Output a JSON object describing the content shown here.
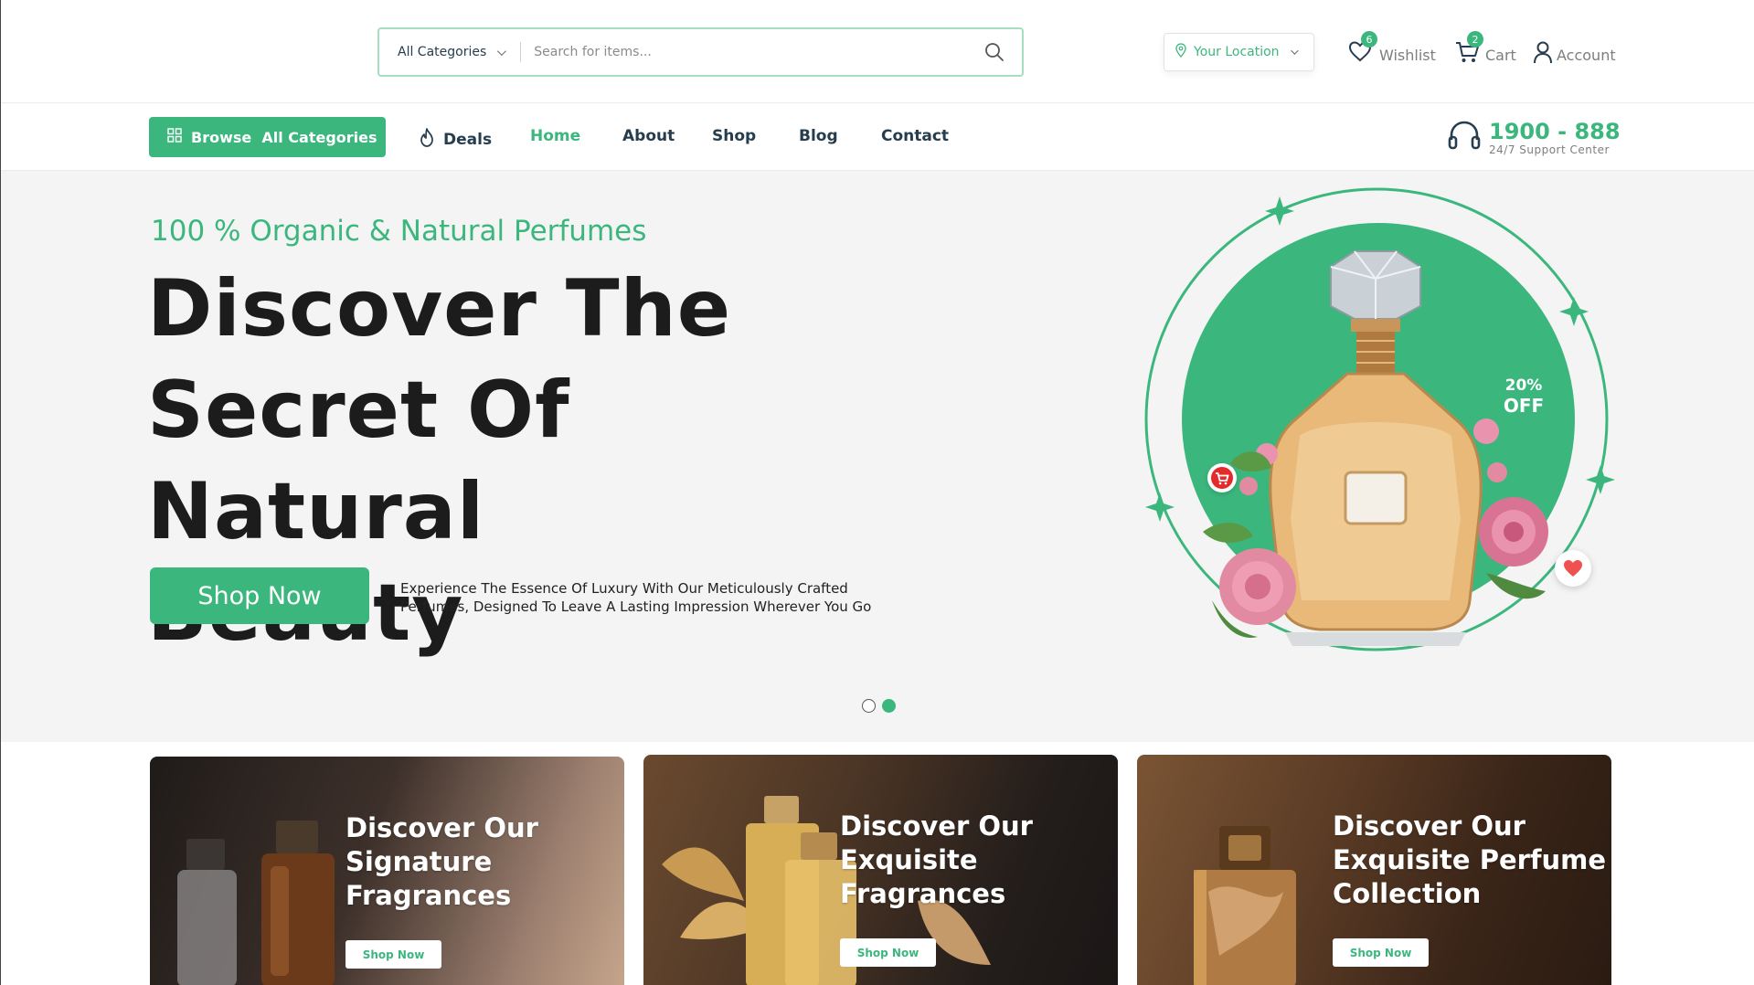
{
  "header": {
    "search": {
      "category_label": "All Categories",
      "placeholder": "Search for items..."
    },
    "location_label": "Your Location",
    "wishlist": {
      "label": "Wishlist",
      "count": "6"
    },
    "cart": {
      "label": "Cart",
      "count": "2"
    },
    "account_label": "Account"
  },
  "nav": {
    "browse_label": "Browse  All Categories",
    "items": [
      {
        "label": "Deals"
      },
      {
        "label": "Home"
      },
      {
        "label": "About"
      },
      {
        "label": "Shop"
      },
      {
        "label": "Blog"
      },
      {
        "label": "Contact"
      }
    ],
    "active_item": "Home",
    "support": {
      "phone": "1900 - 888",
      "label": "24/7 Support Center"
    }
  },
  "hero": {
    "eyebrow": "100 % Organic & Natural Perfumes",
    "headline_lines": [
      "Discover The",
      "Secret Of",
      "Natural Beauty"
    ],
    "button_label": "Shop Now",
    "description": "Experience The Essence Of Luxury With Our Meticulously Crafted Perfumes, Designed To Leave A Lasting Impression Wherever You Go",
    "discount": {
      "percent": "20%",
      "label": "OFF"
    },
    "slides": {
      "total": 2,
      "active": 2
    }
  },
  "banners": [
    {
      "title_lines": [
        "Discover Our",
        "Signature",
        "Fragrances"
      ],
      "button_label": "Shop Now"
    },
    {
      "title_lines": [
        "Discover Our",
        "Exquisite",
        "Fragrances"
      ],
      "button_label": "Shop Now"
    },
    {
      "title_lines": [
        "Discover Our",
        "Exquisite Perfume",
        "Collection"
      ],
      "button_label": "Shop Now"
    }
  ],
  "colors": {
    "accent": "#3bb77e",
    "heading": "#1c1c1c",
    "text": "#253d4e",
    "hero_bg": "#f4f4f4"
  },
  "icons": [
    "search-icon",
    "location-pin-icon",
    "heart-icon",
    "cart-icon",
    "user-icon",
    "grid-icon",
    "fire-icon",
    "headset-icon",
    "chevron-down-icon"
  ]
}
